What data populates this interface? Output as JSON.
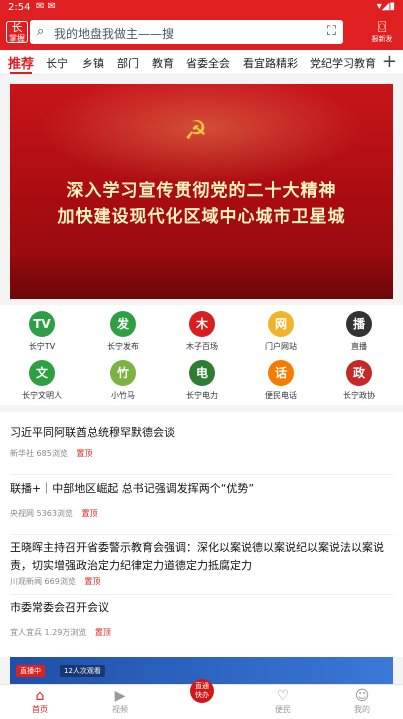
{
  "status": {
    "time": "2:54",
    "icons": "✉ ✉"
  },
  "header": {
    "logo": {
      "mark": "长",
      "label": "掌握"
    },
    "search_placeholder": "我的地盘我做主——搜",
    "camera_label": "报新发"
  },
  "tabs": [
    "推荐",
    "长宁",
    "乡镇",
    "部门",
    "教育",
    "省委全会",
    "看宜路精彩",
    "党纪学习教育"
  ],
  "banner": {
    "line1": "深入学习宣传贯彻党的二十大精神",
    "line2": "加快建设现代化区域中心城市卫星城"
  },
  "grid": [
    {
      "label": "长宁TV",
      "color": "#2ea043",
      "glyph": "TV"
    },
    {
      "label": "长宁发布",
      "color": "#2ea043",
      "glyph": "发"
    },
    {
      "label": "木子百场",
      "color": "#d81e1e",
      "glyph": "木"
    },
    {
      "label": "门户网站",
      "color": "#f0b429",
      "glyph": "网"
    },
    {
      "label": "直播",
      "color": "#333333",
      "glyph": "播"
    },
    {
      "label": "长宁文明人",
      "color": "#2ea043",
      "glyph": "文"
    },
    {
      "label": "小竹马",
      "color": "#7cb342",
      "glyph": "竹"
    },
    {
      "label": "长宁电力",
      "color": "#2e7d32",
      "glyph": "电"
    },
    {
      "label": "便民电话",
      "color": "#f57c00",
      "glyph": "话"
    },
    {
      "label": "长宁政协",
      "color": "#c62828",
      "glyph": "政"
    }
  ],
  "news": [
    {
      "title": "习近平同阿联酋总统穆罕默德会谈",
      "source": "新华社",
      "views": "685浏览",
      "tag": "置顶"
    },
    {
      "title": "联播+｜中部地区崛起 总书记强调发挥两个“优势”",
      "source": "央视网",
      "views": "5363浏览",
      "tag": "置顶"
    },
    {
      "title": "王晓晖主持召开省委警示教育会强调：深化以案说德以案说纪以案说法以案说责，切实增强政治定力纪律定力道德定力抵腐定力",
      "source": "川观新闻",
      "views": "669浏览",
      "tag": "置顶"
    },
    {
      "title": "市委常委会召开会议",
      "source": "宜人宜兵",
      "views": "1.29万浏览",
      "tag": "置顶"
    }
  ],
  "live": {
    "badge": "直播中",
    "count": "12人次观看"
  },
  "bottom_nav": [
    {
      "label": "首页",
      "icon": "home-icon",
      "glyph": "⌂"
    },
    {
      "label": "视频",
      "icon": "video-icon",
      "glyph": "▶"
    },
    {
      "label": "",
      "icon": "center-logo",
      "glyph": "直通\n快办"
    },
    {
      "label": "便民",
      "icon": "heart-icon",
      "glyph": "♡"
    },
    {
      "label": "我的",
      "icon": "user-icon",
      "glyph": "☺"
    }
  ]
}
